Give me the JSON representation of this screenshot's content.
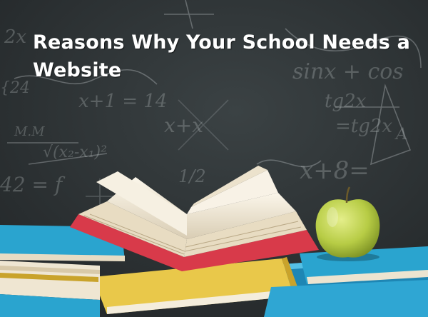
{
  "article": {
    "headline": "Reasons Why Your School Needs a Website"
  },
  "image": {
    "subject": "chalkboard with math formulas, stack of books and a green apple"
  },
  "colors": {
    "chalkboard": "#2c3133",
    "chalk": "#c9cfd0",
    "book_blue": "#2aa4cf",
    "book_yellow": "#e9c84a",
    "book_red": "#d83a4a",
    "apple": "#b7cc45",
    "headline": "#ffffff"
  }
}
